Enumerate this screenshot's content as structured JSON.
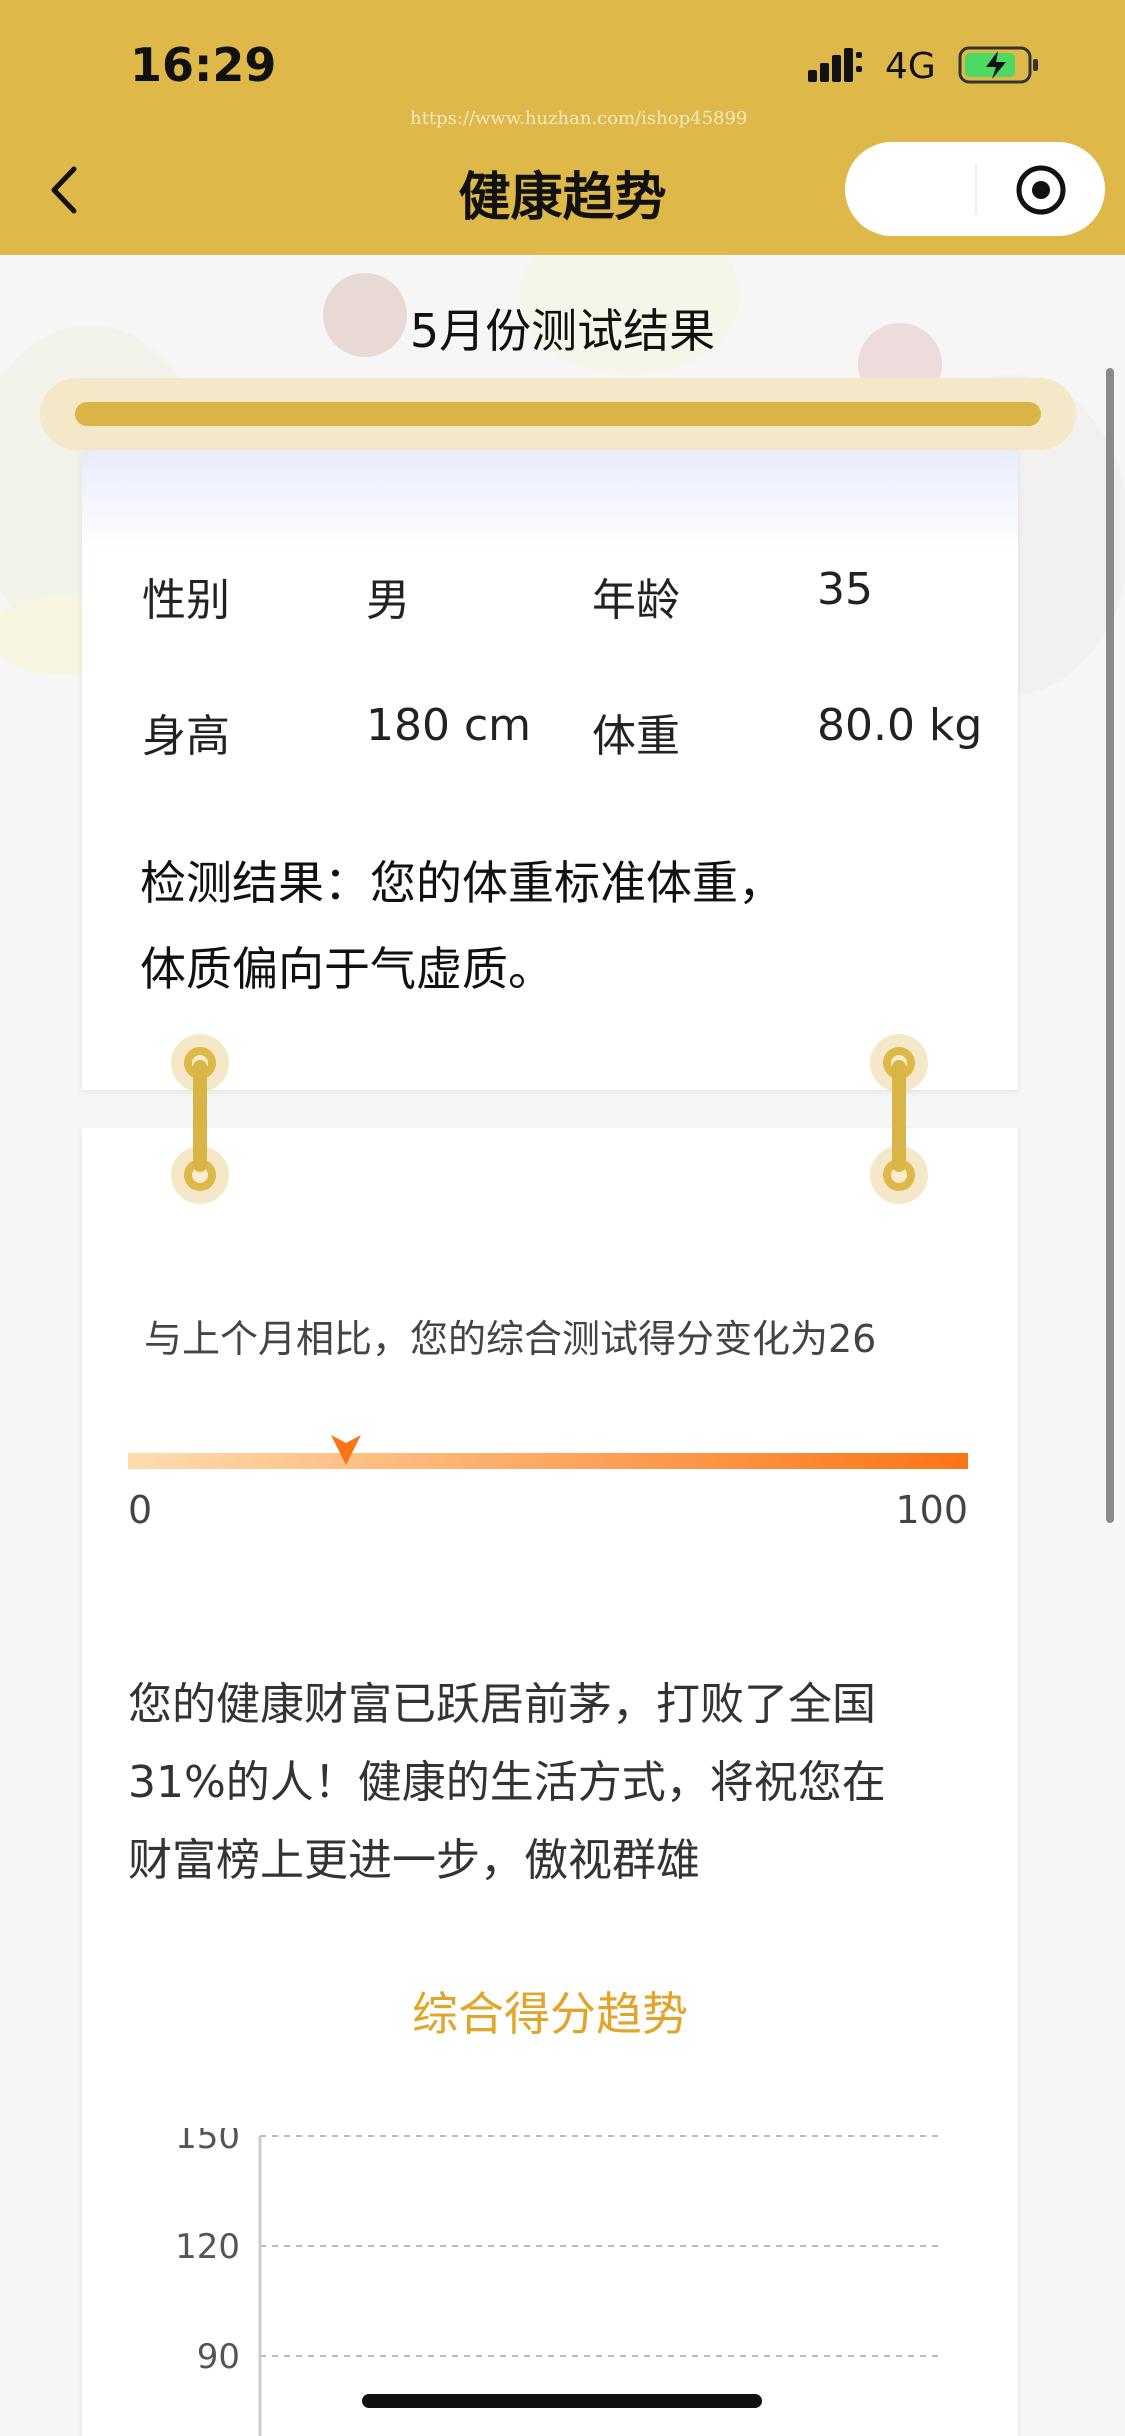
{
  "status_bar": {
    "time": "16:29",
    "network": "4G"
  },
  "watermark": "https://www.huzhan.com/ishop45899",
  "header": {
    "title": "健康趋势"
  },
  "month_title": "5月份测试结果",
  "profile": {
    "gender_label": "性别",
    "gender": "男",
    "age_label": "年龄",
    "age": "35",
    "height_label": "身高",
    "height": "180 cm",
    "weight_label": "体重",
    "weight": "80.0 kg"
  },
  "result": {
    "line1": "检测结果：您的体重标准体重，",
    "line2": "体质偏向于气虚质。"
  },
  "score": {
    "compare_text": "与上个月相比，您的综合测试得分变化为26",
    "value": 26,
    "min_label": "0",
    "max_label": "100",
    "bar_colors": [
      "#ffdcae",
      "#fb7416"
    ]
  },
  "description": {
    "line1": "您的健康财富已跃居前茅，打败了全国",
    "line2": "31%的人！健康的生活方式，将祝您在",
    "line3": "财富榜上更进一步，傲视群雄"
  },
  "chart_data": {
    "type": "line",
    "title": "综合得分趋势",
    "xlabel": "",
    "ylabel": "",
    "y_ticks": [
      "150",
      "120",
      "90"
    ],
    "ylim": [
      90,
      150
    ],
    "grid": true,
    "series": []
  },
  "colors": {
    "header_bg": "#dfb84a",
    "accent_gold": "#d9b548",
    "chart_title": "#e2a52a",
    "score_orange": "#fb7416"
  },
  "icons": {
    "back": "chevron-left-icon",
    "capsule": "target-icon",
    "signal": "signal-icon",
    "battery": "battery-charging-icon"
  }
}
